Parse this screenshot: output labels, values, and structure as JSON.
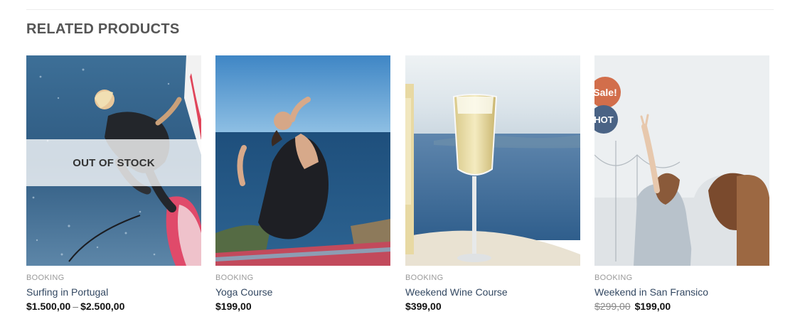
{
  "section": {
    "title": "RELATED PRODUCTS"
  },
  "colors": {
    "sale_badge": "#d26e4b",
    "hot_badge": "#4a6385",
    "title_link": "#334862"
  },
  "products": [
    {
      "image": "surfing-image",
      "category": "BOOKING",
      "title": "Surfing in Portugal",
      "price_min": "$1.500,00",
      "price_separator": "–",
      "price_max": "$2.500,00",
      "overlay_label": "OUT OF STOCK"
    },
    {
      "image": "yoga-image",
      "category": "BOOKING",
      "title": "Yoga Course",
      "price": "$199,00"
    },
    {
      "image": "wine-glass-image",
      "category": "BOOKING",
      "title": "Weekend Wine Course",
      "price": "$399,00"
    },
    {
      "image": "san-francisco-image",
      "category": "BOOKING",
      "title": "Weekend in San Fransico",
      "price_old": "$299,00",
      "price": "$199,00",
      "badges": [
        "Sale!",
        "HOT"
      ]
    }
  ]
}
